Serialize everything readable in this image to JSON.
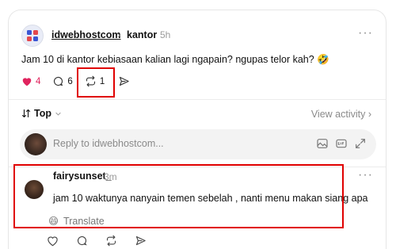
{
  "post": {
    "username": "idwebhostcom",
    "separator": "›",
    "topic": "kantor",
    "time": "5h",
    "more": "···",
    "text": "Jam 10 di kantor kebiasaan kalian lagi ngapain? ngupas telor kah? 🤣",
    "likes": "4",
    "replies": "6",
    "reposts": "1"
  },
  "sort": {
    "label": "Top",
    "view_activity": "View activity ›"
  },
  "reply_box": {
    "placeholder": "Reply to idwebhostcom..."
  },
  "comment": {
    "username": "fairysunset_",
    "time": "3m",
    "more": "···",
    "text": "jam 10 waktunya nanyain temen sebelah , nanti menu makan siang apa",
    "translate_emoji": "😄",
    "translate": "Translate"
  },
  "colors": {
    "like": "#e0245e",
    "annotation": "#e00000"
  }
}
